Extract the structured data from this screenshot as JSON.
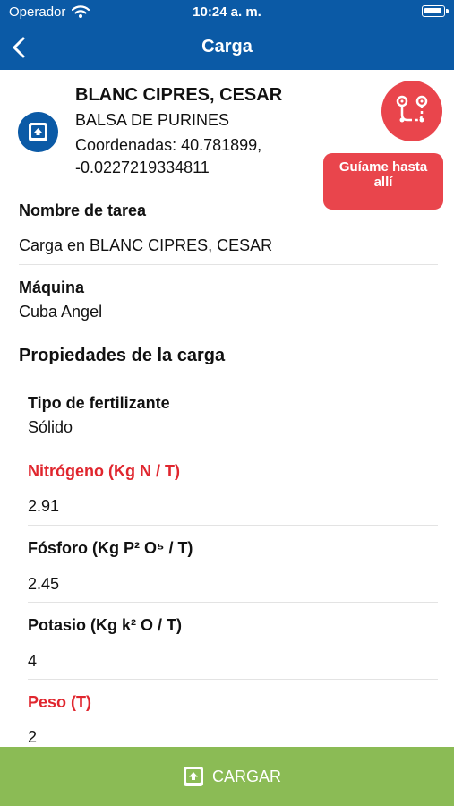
{
  "status_bar": {
    "carrier": "Operador",
    "time": "10:24 a. m."
  },
  "nav": {
    "title": "Carga"
  },
  "farm": {
    "name": "BLANC CIPRES, CESAR",
    "type": "BALSA DE PURINES",
    "coords_line1": "Coordenadas: 40.781899,",
    "coords_line2": "-0.0227219334811"
  },
  "actions": {
    "guide_label": "Guíame hasta allí"
  },
  "task": {
    "label": "Nombre de tarea",
    "value": "Carga en BLANC CIPRES, CESAR"
  },
  "machine": {
    "label": "Máquina",
    "value": "Cuba Angel"
  },
  "properties": {
    "title": "Propiedades de la carga",
    "fertilizer_label": "Tipo de fertilizante",
    "fertilizer_value": "Sólido",
    "nitrogen_label": "Nitrógeno (Kg N / T)",
    "nitrogen_value": "2.91",
    "phosphorus_label": "Fósforo (Kg P² O⁵ / T)",
    "phosphorus_value": "2.45",
    "potassium_label": "Potasio (Kg k² O / T)",
    "potassium_value": "4",
    "weight_label": "Peso (T)",
    "weight_value": "2"
  },
  "footer": {
    "cargar_label": "CARGAR"
  },
  "colors": {
    "primary": "#0b5aa6",
    "accent_red": "#e9454c",
    "required": "#e0262e",
    "action_green": "#8bbb55"
  },
  "icons": {
    "back": "chevron-left-icon",
    "farm": "farm-upload-icon",
    "route": "route-icon",
    "cargar": "upload-icon"
  }
}
